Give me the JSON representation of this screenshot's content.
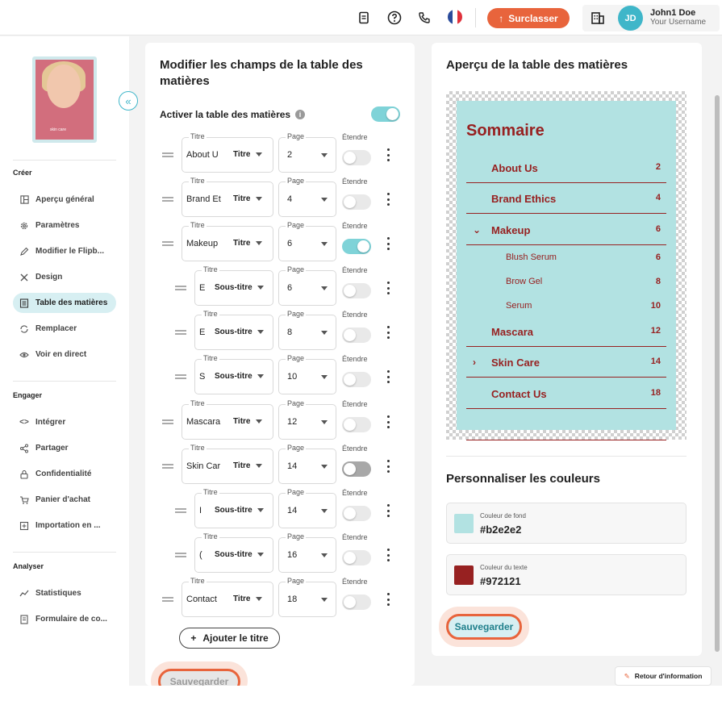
{
  "topbar": {
    "icons": [
      "document-icon",
      "help-icon",
      "phone-icon",
      "flag-fr-icon"
    ],
    "upgrade_label": "Surclasser",
    "org_icon": "building-icon",
    "avatar_initials": "JD",
    "user_name": "John1 Doe",
    "user_sub": "Your Username"
  },
  "sidebar": {
    "cover_text": "skin care",
    "sections": [
      {
        "title": "Créer",
        "items": [
          {
            "label": "Aperçu général",
            "icon": "overview-icon"
          },
          {
            "label": "Paramètres",
            "icon": "gear-icon"
          },
          {
            "label": "Modifier le Flipb...",
            "icon": "pencil-icon"
          },
          {
            "label": "Design",
            "icon": "design-icon"
          },
          {
            "label": "Table des matières",
            "icon": "toc-icon",
            "active": true
          },
          {
            "label": "Remplacer",
            "icon": "replace-icon"
          },
          {
            "label": "Voir en direct",
            "icon": "eye-icon"
          }
        ]
      },
      {
        "title": "Engager",
        "items": [
          {
            "label": "Intégrer",
            "icon": "code-icon"
          },
          {
            "label": "Partager",
            "icon": "share-icon"
          },
          {
            "label": "Confidentialité",
            "icon": "lock-icon"
          },
          {
            "label": "Panier d'achat",
            "icon": "cart-icon"
          },
          {
            "label": "Importation en ...",
            "icon": "import-icon"
          }
        ]
      },
      {
        "title": "Analyser",
        "items": [
          {
            "label": "Statistiques",
            "icon": "stats-icon"
          },
          {
            "label": "Formulaire de co...",
            "icon": "form-icon"
          }
        ]
      }
    ]
  },
  "editor": {
    "title": "Modifier les champs de la table des matières",
    "activate_label": "Activer la table des matières",
    "activate_on": true,
    "field_labels": {
      "title": "Titre",
      "page": "Page",
      "extend": "Étendre"
    },
    "rows": [
      {
        "title": "About U",
        "type": "Titre",
        "page": "2",
        "indent": false,
        "extend": "off"
      },
      {
        "title": "Brand Et",
        "type": "Titre",
        "page": "4",
        "indent": false,
        "extend": "off"
      },
      {
        "title": "Makeup",
        "type": "Titre",
        "page": "6",
        "indent": false,
        "extend": "on"
      },
      {
        "title": "E",
        "type": "Sous-titre",
        "page": "6",
        "indent": true,
        "extend": "off"
      },
      {
        "title": "E",
        "type": "Sous-titre",
        "page": "8",
        "indent": true,
        "extend": "off"
      },
      {
        "title": "S",
        "type": "Sous-titre",
        "page": "10",
        "indent": true,
        "extend": "off"
      },
      {
        "title": "Mascara",
        "type": "Titre",
        "page": "12",
        "indent": false,
        "extend": "off"
      },
      {
        "title": "Skin Car",
        "type": "Titre",
        "page": "14",
        "indent": false,
        "extend": "gray"
      },
      {
        "title": "I",
        "type": "Sous-titre",
        "page": "14",
        "indent": true,
        "extend": "off"
      },
      {
        "title": "(",
        "type": "Sous-titre",
        "page": "16",
        "indent": true,
        "extend": "off"
      },
      {
        "title": "Contact",
        "type": "Titre",
        "page": "18",
        "indent": false,
        "extend": "off"
      }
    ],
    "add_label": "Ajouter le titre",
    "save_label": "Sauvegarder"
  },
  "preview": {
    "title": "Aperçu de la table des matières",
    "toc_heading": "Sommaire",
    "entries": [
      {
        "title": "About Us",
        "page": "2",
        "level": 1,
        "chevron": ""
      },
      {
        "title": "Brand Ethics",
        "page": "4",
        "level": 1,
        "chevron": ""
      },
      {
        "title": "Makeup",
        "page": "6",
        "level": 1,
        "chevron": "⌄"
      },
      {
        "title": "Blush Serum",
        "page": "6",
        "level": 2,
        "chevron": ""
      },
      {
        "title": "Brow Gel",
        "page": "8",
        "level": 2,
        "chevron": ""
      },
      {
        "title": "Serum",
        "page": "10",
        "level": 2,
        "chevron": ""
      },
      {
        "title": "Mascara",
        "page": "12",
        "level": 1,
        "chevron": ""
      },
      {
        "title": "Skin Care",
        "page": "14",
        "level": 1,
        "chevron": "›"
      },
      {
        "title": "Contact Us",
        "page": "18",
        "level": 1,
        "chevron": ""
      }
    ],
    "colors_title": "Personnaliser les couleurs",
    "bg_label": "Couleur de fond",
    "bg_value": "#b2e2e2",
    "text_label": "Couleur du texte",
    "text_value": "#972121",
    "save_label": "Sauvegarder"
  },
  "feedback_label": "Retour d'information",
  "colors": {
    "accent": "#e8643c",
    "teal": "#3fb6c9",
    "toc_bg": "#b2e2e2",
    "toc_text": "#972121"
  }
}
